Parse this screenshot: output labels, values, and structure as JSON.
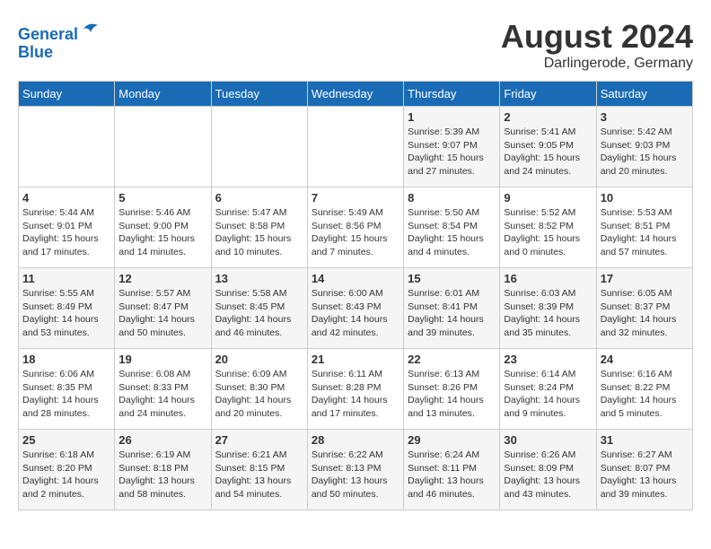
{
  "header": {
    "logo_line1": "General",
    "logo_line2": "Blue",
    "month_year": "August 2024",
    "location": "Darlingerode, Germany"
  },
  "weekdays": [
    "Sunday",
    "Monday",
    "Tuesday",
    "Wednesday",
    "Thursday",
    "Friday",
    "Saturday"
  ],
  "weeks": [
    [
      {
        "day": "",
        "info": ""
      },
      {
        "day": "",
        "info": ""
      },
      {
        "day": "",
        "info": ""
      },
      {
        "day": "",
        "info": ""
      },
      {
        "day": "1",
        "info": "Sunrise: 5:39 AM\nSunset: 9:07 PM\nDaylight: 15 hours\nand 27 minutes."
      },
      {
        "day": "2",
        "info": "Sunrise: 5:41 AM\nSunset: 9:05 PM\nDaylight: 15 hours\nand 24 minutes."
      },
      {
        "day": "3",
        "info": "Sunrise: 5:42 AM\nSunset: 9:03 PM\nDaylight: 15 hours\nand 20 minutes."
      }
    ],
    [
      {
        "day": "4",
        "info": "Sunrise: 5:44 AM\nSunset: 9:01 PM\nDaylight: 15 hours\nand 17 minutes."
      },
      {
        "day": "5",
        "info": "Sunrise: 5:46 AM\nSunset: 9:00 PM\nDaylight: 15 hours\nand 14 minutes."
      },
      {
        "day": "6",
        "info": "Sunrise: 5:47 AM\nSunset: 8:58 PM\nDaylight: 15 hours\nand 10 minutes."
      },
      {
        "day": "7",
        "info": "Sunrise: 5:49 AM\nSunset: 8:56 PM\nDaylight: 15 hours\nand 7 minutes."
      },
      {
        "day": "8",
        "info": "Sunrise: 5:50 AM\nSunset: 8:54 PM\nDaylight: 15 hours\nand 4 minutes."
      },
      {
        "day": "9",
        "info": "Sunrise: 5:52 AM\nSunset: 8:52 PM\nDaylight: 15 hours\nand 0 minutes."
      },
      {
        "day": "10",
        "info": "Sunrise: 5:53 AM\nSunset: 8:51 PM\nDaylight: 14 hours\nand 57 minutes."
      }
    ],
    [
      {
        "day": "11",
        "info": "Sunrise: 5:55 AM\nSunset: 8:49 PM\nDaylight: 14 hours\nand 53 minutes."
      },
      {
        "day": "12",
        "info": "Sunrise: 5:57 AM\nSunset: 8:47 PM\nDaylight: 14 hours\nand 50 minutes."
      },
      {
        "day": "13",
        "info": "Sunrise: 5:58 AM\nSunset: 8:45 PM\nDaylight: 14 hours\nand 46 minutes."
      },
      {
        "day": "14",
        "info": "Sunrise: 6:00 AM\nSunset: 8:43 PM\nDaylight: 14 hours\nand 42 minutes."
      },
      {
        "day": "15",
        "info": "Sunrise: 6:01 AM\nSunset: 8:41 PM\nDaylight: 14 hours\nand 39 minutes."
      },
      {
        "day": "16",
        "info": "Sunrise: 6:03 AM\nSunset: 8:39 PM\nDaylight: 14 hours\nand 35 minutes."
      },
      {
        "day": "17",
        "info": "Sunrise: 6:05 AM\nSunset: 8:37 PM\nDaylight: 14 hours\nand 32 minutes."
      }
    ],
    [
      {
        "day": "18",
        "info": "Sunrise: 6:06 AM\nSunset: 8:35 PM\nDaylight: 14 hours\nand 28 minutes."
      },
      {
        "day": "19",
        "info": "Sunrise: 6:08 AM\nSunset: 8:33 PM\nDaylight: 14 hours\nand 24 minutes."
      },
      {
        "day": "20",
        "info": "Sunrise: 6:09 AM\nSunset: 8:30 PM\nDaylight: 14 hours\nand 20 minutes."
      },
      {
        "day": "21",
        "info": "Sunrise: 6:11 AM\nSunset: 8:28 PM\nDaylight: 14 hours\nand 17 minutes."
      },
      {
        "day": "22",
        "info": "Sunrise: 6:13 AM\nSunset: 8:26 PM\nDaylight: 14 hours\nand 13 minutes."
      },
      {
        "day": "23",
        "info": "Sunrise: 6:14 AM\nSunset: 8:24 PM\nDaylight: 14 hours\nand 9 minutes."
      },
      {
        "day": "24",
        "info": "Sunrise: 6:16 AM\nSunset: 8:22 PM\nDaylight: 14 hours\nand 5 minutes."
      }
    ],
    [
      {
        "day": "25",
        "info": "Sunrise: 6:18 AM\nSunset: 8:20 PM\nDaylight: 14 hours\nand 2 minutes."
      },
      {
        "day": "26",
        "info": "Sunrise: 6:19 AM\nSunset: 8:18 PM\nDaylight: 13 hours\nand 58 minutes."
      },
      {
        "day": "27",
        "info": "Sunrise: 6:21 AM\nSunset: 8:15 PM\nDaylight: 13 hours\nand 54 minutes."
      },
      {
        "day": "28",
        "info": "Sunrise: 6:22 AM\nSunset: 8:13 PM\nDaylight: 13 hours\nand 50 minutes."
      },
      {
        "day": "29",
        "info": "Sunrise: 6:24 AM\nSunset: 8:11 PM\nDaylight: 13 hours\nand 46 minutes."
      },
      {
        "day": "30",
        "info": "Sunrise: 6:26 AM\nSunset: 8:09 PM\nDaylight: 13 hours\nand 43 minutes."
      },
      {
        "day": "31",
        "info": "Sunrise: 6:27 AM\nSunset: 8:07 PM\nDaylight: 13 hours\nand 39 minutes."
      }
    ]
  ]
}
